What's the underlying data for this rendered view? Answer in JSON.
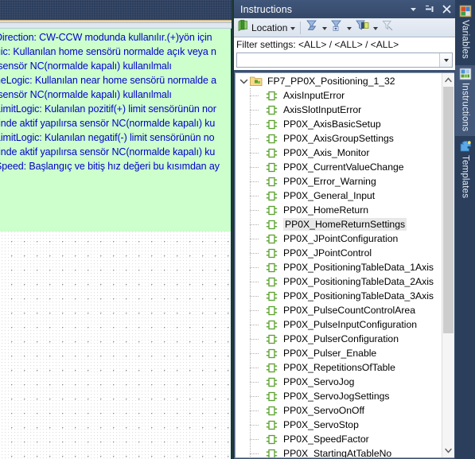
{
  "editor": {
    "comment_lines": [
      "Direction: CW-CCW modunda kullanılır.(+)yön için",
      "gic: Kullanılan home sensörü normalde açık veya n",
      " sensör NC(normalde kapalı) kullanılmalı",
      "neLogic: Kullanılan near home sensörü normalde a",
      " sensör NC(normalde kapalı) kullanılmalı",
      "LimitLogic: Kulanılan pozitif(+) limit sensörünün nor",
      "rinde aktif yapılırsa sensör NC(normalde kapalı) ku",
      "LimitLogic: Kulanılan negatif(-) limit sensörünün no",
      "rinde aktif yapılırsa sensör NC(normalde kapalı) ku",
      "Speed: Başlangıç ve bitiş hız değeri bu kısımdan ay"
    ],
    "comment_text_color": "#0000cc",
    "comment_bg_color": "#ccffcc"
  },
  "instructions_panel": {
    "title": "Instructions",
    "title_buttons": [
      {
        "name": "dropdown-menu-button",
        "glyph": "▾"
      },
      {
        "name": "auto-hide-button",
        "glyph": "⇥"
      },
      {
        "name": "close-button",
        "glyph": "✕"
      }
    ],
    "toolbar": {
      "location_label": "Location",
      "buttons": [
        {
          "name": "location-button",
          "label": "Location",
          "has_caret": true
        },
        {
          "name": "filter-button",
          "label": "",
          "has_caret": true
        },
        {
          "name": "add-filter-button",
          "label": "",
          "has_caret": true
        },
        {
          "name": "edit-filter-button",
          "label": "",
          "has_caret": true
        },
        {
          "name": "clear-filter-button",
          "label": "",
          "has_caret": false
        }
      ]
    },
    "filter_settings_label": "Filter settings: <ALL> / <ALL> / <ALL>",
    "filter_input_value": "",
    "filter_input_placeholder": "",
    "tree": {
      "root": {
        "label": "FP7_PP0X_Positioning_1_32",
        "expanded": true,
        "expander_glyph": "⌄"
      },
      "items": [
        {
          "label": "AxisInputError",
          "selected": false
        },
        {
          "label": "AxisSlotInputError",
          "selected": false
        },
        {
          "label": "PP0X_AxisBasicSetup",
          "selected": false
        },
        {
          "label": "PP0X_AxisGroupSettings",
          "selected": false
        },
        {
          "label": "PP0X_Axis_Monitor",
          "selected": false
        },
        {
          "label": "PP0X_CurrentValueChange",
          "selected": false
        },
        {
          "label": "PP0X_Error_Warning",
          "selected": false
        },
        {
          "label": "PP0X_General_Input",
          "selected": false
        },
        {
          "label": "PP0X_HomeReturn",
          "selected": false
        },
        {
          "label": "PP0X_HomeReturnSettings",
          "selected": true
        },
        {
          "label": "PP0X_JPointConfiguration",
          "selected": false
        },
        {
          "label": "PP0X_JPointControl",
          "selected": false
        },
        {
          "label": "PP0X_PositioningTableData_1Axis",
          "selected": false
        },
        {
          "label": "PP0X_PositioningTableData_2Axis",
          "selected": false
        },
        {
          "label": "PP0X_PositioningTableData_3Axis",
          "selected": false
        },
        {
          "label": "PP0X_PulseCountControlArea",
          "selected": false
        },
        {
          "label": "PP0X_PulseInputConfiguration",
          "selected": false
        },
        {
          "label": "PP0X_PulserConfiguration",
          "selected": false
        },
        {
          "label": "PP0X_Pulser_Enable",
          "selected": false
        },
        {
          "label": "PP0X_RepetitionsOfTable",
          "selected": false
        },
        {
          "label": "PP0X_ServoJog",
          "selected": false
        },
        {
          "label": "PP0X_ServoJogSettings",
          "selected": false
        },
        {
          "label": "PP0X_ServoOnOff",
          "selected": false
        },
        {
          "label": "PP0X_ServoStop",
          "selected": false
        },
        {
          "label": "PP0X_SpeedFactor",
          "selected": false
        },
        {
          "label": "PP0X_StartingAtTableNo",
          "selected": false
        }
      ]
    },
    "scrollbar": {
      "up_arrow": "⌃",
      "down_arrow": "⌄"
    }
  },
  "vertical_tabs": [
    {
      "label": "Variables",
      "icon": "variables-icon",
      "active": false
    },
    {
      "label": "Instructions",
      "icon": "instructions-icon",
      "active": true
    },
    {
      "label": "Templates",
      "icon": "templates-icon",
      "active": false
    }
  ],
  "colors": {
    "panel_chrome": "#2b3f5c",
    "titlebar": "#3b5075",
    "accent_line": "#eed9a8",
    "selection": "#e8e8e8",
    "fb_icon_green": "#5aa02c"
  }
}
